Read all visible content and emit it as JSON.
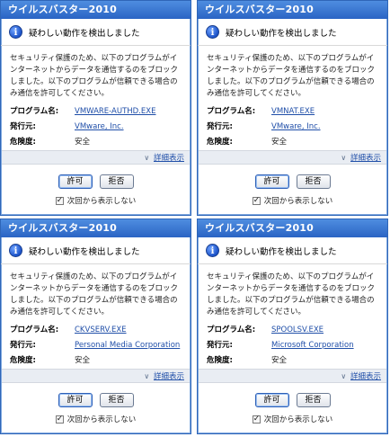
{
  "dialogs": [
    {
      "title": "ウイルスバスター2010",
      "alert": "疑わしい動作を検出しました",
      "message": "セキュリティ保護のため、以下のプログラムがインターネットからデータを通信するのをブロックしました。以下のプログラムが信頼できる場合のみ通信を許可してください。",
      "program_label": "プログラム名:",
      "program_value": "VMWARE-AUTHD.EXE",
      "publisher_label": "発行元:",
      "publisher_value": "VMware, Inc.",
      "risk_label": "危険度:",
      "risk_value": "安全",
      "details_label": "詳細表示",
      "allow_label": "許可",
      "deny_label": "拒否",
      "checkbox_label": "次回から表示しない",
      "checked": true
    },
    {
      "title": "ウイルスバスター2010",
      "alert": "疑わしい動作を検出しました",
      "message": "セキュリティ保護のため、以下のプログラムがインターネットからデータを通信するのをブロックしました。以下のプログラムが信頼できる場合のみ通信を許可してください。",
      "program_label": "プログラム名:",
      "program_value": "VMNAT.EXE",
      "publisher_label": "発行元:",
      "publisher_value": "VMware, Inc.",
      "risk_label": "危険度:",
      "risk_value": "安全",
      "details_label": "詳細表示",
      "allow_label": "許可",
      "deny_label": "拒否",
      "checkbox_label": "次回から表示しない",
      "checked": true
    },
    {
      "title": "ウイルスバスター2010",
      "alert": "疑わしい動作を検出しました",
      "message": "セキュリティ保護のため、以下のプログラムがインターネットからデータを通信するのをブロックしました。以下のプログラムが信頼できる場合のみ通信を許可してください。",
      "program_label": "プログラム名:",
      "program_value": "CKVSERV.EXE",
      "publisher_label": "発行元:",
      "publisher_value": "Personal Media Corporation",
      "risk_label": "危険度:",
      "risk_value": "安全",
      "details_label": "詳細表示",
      "allow_label": "許可",
      "deny_label": "拒否",
      "checkbox_label": "次回から表示しない",
      "checked": true
    },
    {
      "title": "ウイルスバスター2010",
      "alert": "疑わしい動作を検出しました",
      "message": "セキュリティ保護のため、以下のプログラムがインターネットからデータを通信するのをブロックしました。以下のプログラムが信頼できる場合のみ通信を許可してください。",
      "program_label": "プログラム名:",
      "program_value": "SPOOLSV.EXE",
      "publisher_label": "発行元:",
      "publisher_value": "Microsoft Corporation",
      "risk_label": "危険度:",
      "risk_value": "安全",
      "details_label": "詳細表示",
      "allow_label": "許可",
      "deny_label": "拒否",
      "checkbox_label": "次回から表示しない",
      "checked": true
    }
  ],
  "icons": {
    "info": "info-icon",
    "details": "chevron-down-icon",
    "checkbox": "checkbox-checked-icon"
  },
  "colors": {
    "titlebar": "#2a64c4",
    "link": "#1f4ea8",
    "border": "#2f66b8"
  }
}
